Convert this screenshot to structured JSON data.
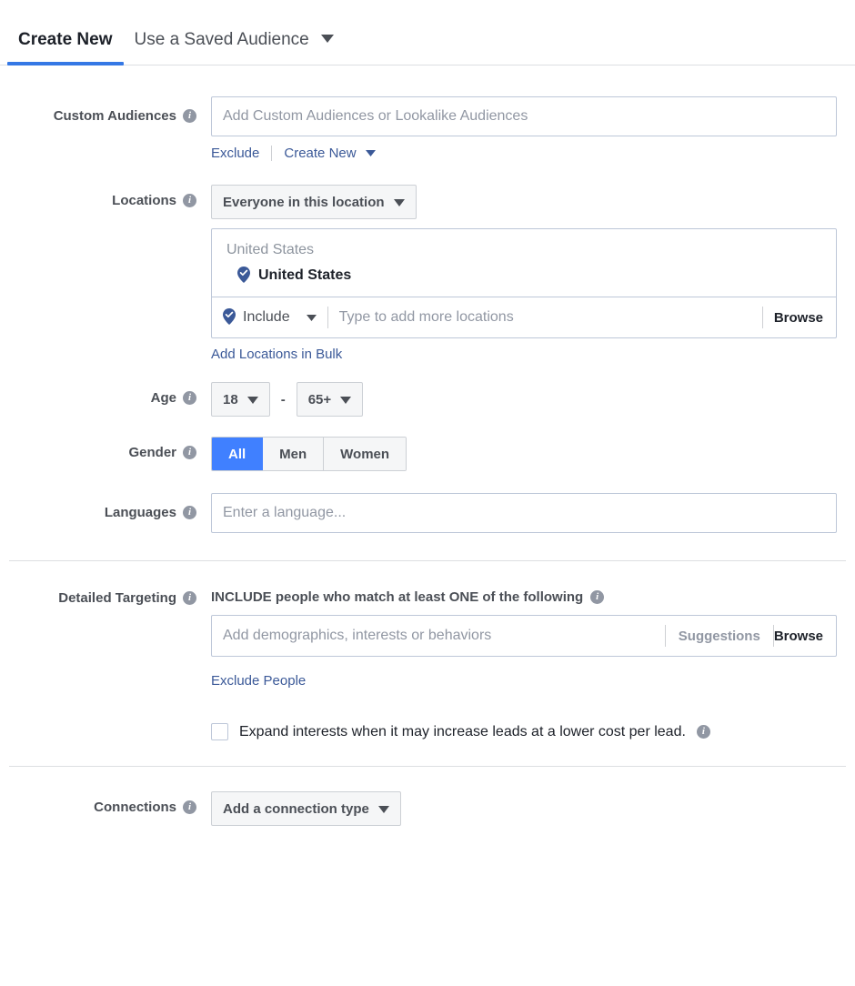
{
  "tabs": [
    {
      "label": "Create New",
      "active": true
    },
    {
      "label": "Use a Saved Audience",
      "active": false,
      "caret": true
    }
  ],
  "custom_audiences": {
    "label": "Custom Audiences",
    "placeholder": "Add Custom Audiences or Lookalike Audiences",
    "value": "",
    "exclude_link": "Exclude",
    "create_new_link": "Create New"
  },
  "locations": {
    "label": "Locations",
    "scope_button": "Everyone in this location",
    "group_header": "United States",
    "selected": [
      {
        "name": "United States",
        "icon": "location-pin-icon"
      }
    ],
    "include_label": "Include",
    "input_placeholder": "Type to add more locations",
    "browse_label": "Browse",
    "bulk_link": "Add Locations in Bulk"
  },
  "age": {
    "label": "Age",
    "min": "18",
    "max": "65+",
    "separator": "-"
  },
  "gender": {
    "label": "Gender",
    "options": [
      "All",
      "Men",
      "Women"
    ],
    "selected": "All"
  },
  "languages": {
    "label": "Languages",
    "placeholder": "Enter a language...",
    "value": ""
  },
  "detailed_targeting": {
    "label": "Detailed Targeting",
    "include_title": "INCLUDE people who match at least ONE of the following",
    "placeholder": "Add demographics, interests or behaviors",
    "suggestions_label": "Suggestions",
    "browse_label": "Browse",
    "exclude_link": "Exclude People",
    "expand_checkbox_label": "Expand interests when it may increase leads at a lower cost per lead.",
    "expand_checked": false
  },
  "connections": {
    "label": "Connections",
    "button": "Add a connection type"
  },
  "colors": {
    "accent_blue": "#3578e5",
    "selected_blue": "#4080ff",
    "link_blue": "#3b5998",
    "pin_blue": "#3b5998",
    "border": "#bdc7d8",
    "divider": "#dddfe2",
    "muted_text": "#9197a3"
  }
}
